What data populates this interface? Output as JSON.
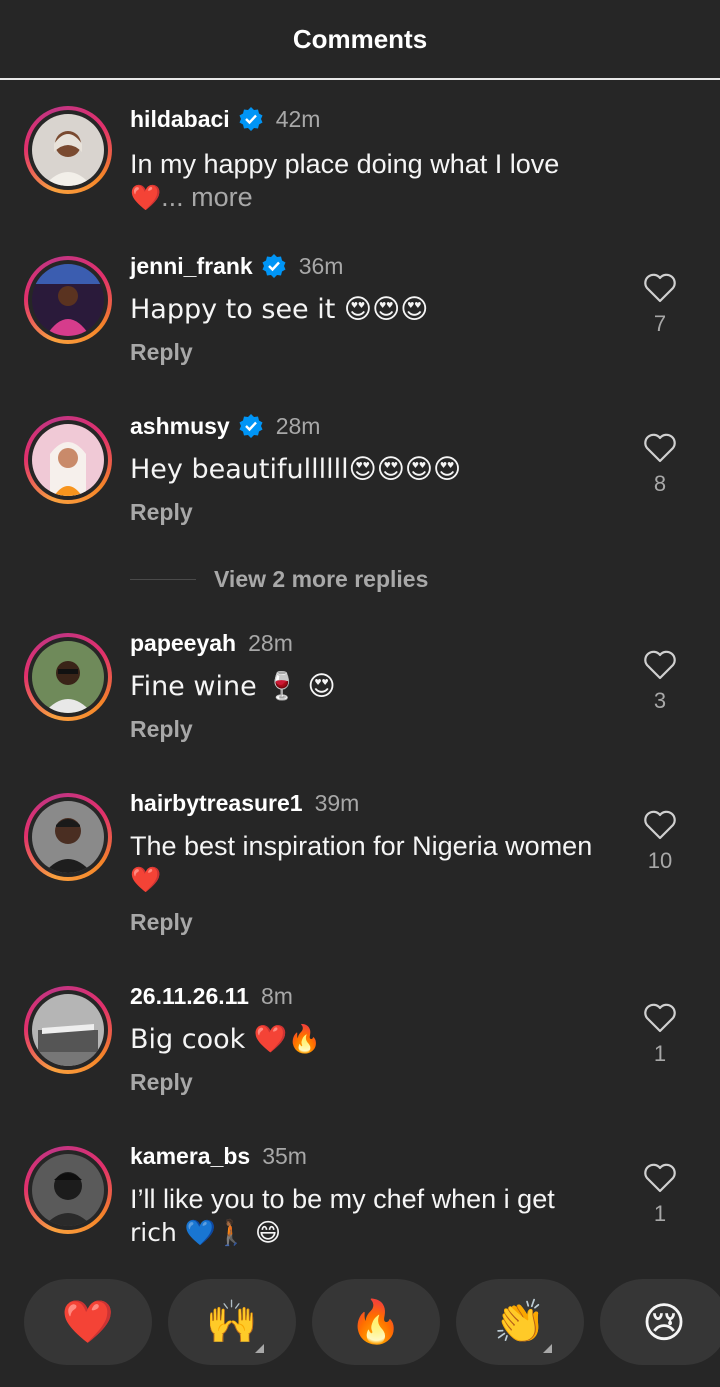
{
  "header": {
    "title": "Comments"
  },
  "comments": [
    {
      "username": "hildabaci",
      "time": "42m",
      "text": "In my happy place doing what I love",
      "text2": "❤️",
      "more": "... more"
    },
    {
      "username": "jenni_frank",
      "time": "36m",
      "text": "Happy to see it 😍😍😍",
      "reply": "Reply",
      "likes": "7"
    },
    {
      "username": "ashmusy",
      "time": "28m",
      "text": "Hey beautifullllll😍😍😍😍",
      "reply": "Reply",
      "likes": "8"
    },
    {
      "username": "papeeyah",
      "time": "28m",
      "text": "Fine wine 🍷 😍",
      "reply": "Reply",
      "likes": "3"
    },
    {
      "username": "hairbytreasure1",
      "time": "39m",
      "text": "The best inspiration for Nigeria women",
      "text2": "❤️",
      "reply": "Reply",
      "likes": "10"
    },
    {
      "username": "26.11.26.11",
      "time": "8m",
      "text": "Big cook ❤️🔥",
      "reply": "Reply",
      "likes": "1"
    },
    {
      "username": "kamera_bs",
      "time": "35m",
      "text": "I’ll like you to be my chef when i get",
      "text2": "rich 💙🚶🏾 😄",
      "likes": "1"
    }
  ],
  "view_replies": "View 2 more replies",
  "emoji_bar": [
    "❤️",
    "🙌",
    "🔥",
    "👏",
    "😢"
  ],
  "colors": {
    "background": "#262626",
    "verified": "#0095f6",
    "secondary_text": "#a8a8a8"
  }
}
